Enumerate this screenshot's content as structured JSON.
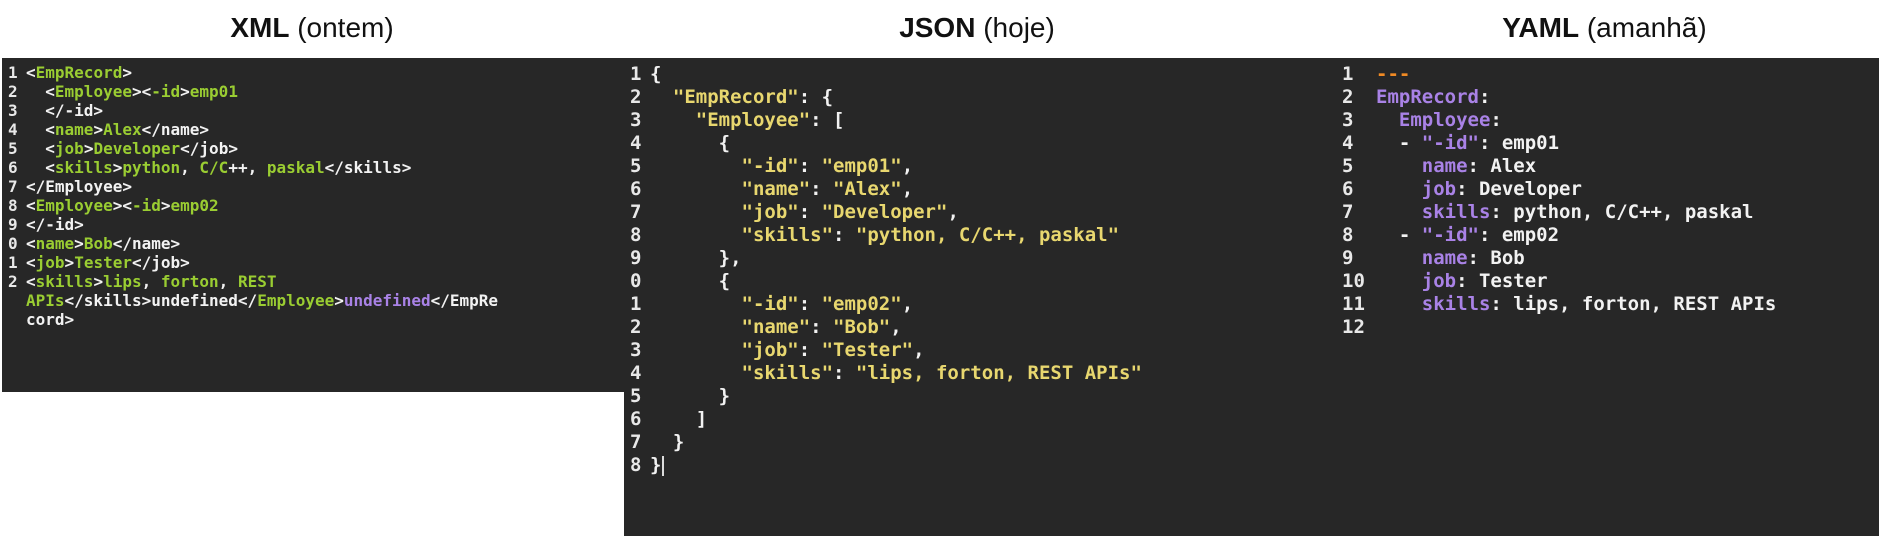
{
  "headings": {
    "xml": {
      "bold": "XML",
      "rest": "(ontem)"
    },
    "json": {
      "bold": "JSON",
      "rest": "(hoje)"
    },
    "yaml": {
      "bold": "YAML",
      "rest": "(amanhã)"
    }
  },
  "xml_panel": {
    "lines": [
      {
        "n": "1",
        "segs": [
          [
            "w",
            "<"
          ],
          [
            "g",
            "EmpRecord"
          ],
          [
            "w",
            ">"
          ]
        ]
      },
      {
        "n": "2",
        "segs": [
          [
            "w",
            "  <"
          ],
          [
            "g",
            "Employee"
          ],
          [
            "w",
            "><"
          ],
          [
            "g",
            "-id"
          ],
          [
            "w",
            ">"
          ],
          [
            "g",
            "emp01"
          ]
        ]
      },
      {
        "n": "3",
        "segs": [
          [
            "w",
            "  </"
          ],
          [
            "w",
            "-id>"
          ]
        ]
      },
      {
        "n": "4",
        "segs": [
          [
            "w",
            "  <"
          ],
          [
            "g",
            "name"
          ],
          [
            "w",
            ">"
          ],
          [
            "g",
            "Alex"
          ],
          [
            "w",
            "</name>"
          ]
        ]
      },
      {
        "n": "5",
        "segs": [
          [
            "w",
            "  <"
          ],
          [
            "g",
            "job"
          ],
          [
            "w",
            ">"
          ],
          [
            "g",
            "Developer"
          ],
          [
            "w",
            "</job>"
          ]
        ]
      },
      {
        "n": "6",
        "segs": [
          [
            "w",
            "  <"
          ],
          [
            "g",
            "skills"
          ],
          [
            "w",
            ">"
          ],
          [
            "g",
            "python"
          ],
          [
            "w",
            ", "
          ],
          [
            "g",
            "C/C"
          ],
          [
            "w",
            "++, "
          ],
          [
            "g",
            "paskal"
          ],
          [
            "w",
            "</skills>"
          ]
        ]
      },
      {
        "n": "7",
        "segs": [
          [
            "w",
            "</Employee>"
          ]
        ]
      },
      {
        "n": "8",
        "segs": [
          [
            "w",
            "<"
          ],
          [
            "g",
            "Employee"
          ],
          [
            "w",
            "><"
          ],
          [
            "g",
            "-id"
          ],
          [
            "w",
            ">"
          ],
          [
            "g",
            "emp02"
          ]
        ]
      },
      {
        "n": "9",
        "segs": [
          [
            "w",
            "</-id>"
          ]
        ]
      },
      {
        "n": "0",
        "segs": [
          [
            "w",
            "<"
          ],
          [
            "g",
            "name"
          ],
          [
            "w",
            ">"
          ],
          [
            "g",
            "Bob"
          ],
          [
            "w",
            "</name>"
          ]
        ]
      },
      {
        "n": "1",
        "segs": [
          [
            "w",
            "<"
          ],
          [
            "g",
            "job"
          ],
          [
            "w",
            ">"
          ],
          [
            "g",
            "Tester"
          ],
          [
            "w",
            "</job>"
          ]
        ]
      },
      {
        "n": "2",
        "segs": [
          [
            "w",
            "<"
          ],
          [
            "g",
            "skills"
          ],
          [
            "w",
            ">"
          ],
          [
            "g",
            "lips"
          ],
          [
            "w",
            ", "
          ],
          [
            "g",
            "forton"
          ],
          [
            "w",
            ", "
          ],
          [
            "g",
            "REST"
          ]
        ]
      },
      {
        "n": "",
        "segs": [
          [
            "g",
            "APIs"
          ],
          [
            "w",
            "</skills>undefined</"
          ],
          [
            "g",
            "Employee"
          ],
          [
            "w",
            ">"
          ],
          [
            "p",
            "undefined"
          ],
          [
            "w",
            "</EmpRe"
          ]
        ]
      },
      {
        "n": "",
        "segs": [
          [
            "w",
            "cord>"
          ]
        ]
      }
    ]
  },
  "json_panel": {
    "lines": [
      {
        "n": "1",
        "segs": [
          [
            "w",
            "{"
          ]
        ]
      },
      {
        "n": "2",
        "segs": [
          [
            "y",
            "  \"EmpRecord\""
          ],
          [
            "w",
            ": {"
          ]
        ]
      },
      {
        "n": "3",
        "segs": [
          [
            "y",
            "    \"Employee\""
          ],
          [
            "w",
            ": ["
          ]
        ]
      },
      {
        "n": "4",
        "segs": [
          [
            "w",
            "      {"
          ]
        ]
      },
      {
        "n": "5",
        "segs": [
          [
            "y",
            "        \"-id\""
          ],
          [
            "w",
            ": "
          ],
          [
            "y",
            "\"emp01\""
          ],
          [
            "w",
            ","
          ]
        ]
      },
      {
        "n": "6",
        "segs": [
          [
            "y",
            "        \"name\""
          ],
          [
            "w",
            ": "
          ],
          [
            "y",
            "\"Alex\""
          ],
          [
            "w",
            ","
          ]
        ]
      },
      {
        "n": "7",
        "segs": [
          [
            "y",
            "        \"job\""
          ],
          [
            "w",
            ": "
          ],
          [
            "y",
            "\"Developer\""
          ],
          [
            "w",
            ","
          ]
        ]
      },
      {
        "n": "8",
        "segs": [
          [
            "y",
            "        \"skills\""
          ],
          [
            "w",
            ": "
          ],
          [
            "y",
            "\"python, C/C++, paskal\""
          ]
        ]
      },
      {
        "n": "9",
        "segs": [
          [
            "w",
            "      },"
          ]
        ]
      },
      {
        "n": "0",
        "segs": [
          [
            "w",
            "      {"
          ]
        ]
      },
      {
        "n": "1",
        "segs": [
          [
            "y",
            "        \"-id\""
          ],
          [
            "w",
            ": "
          ],
          [
            "y",
            "\"emp02\""
          ],
          [
            "w",
            ","
          ]
        ]
      },
      {
        "n": "2",
        "segs": [
          [
            "y",
            "        \"name\""
          ],
          [
            "w",
            ": "
          ],
          [
            "y",
            "\"Bob\""
          ],
          [
            "w",
            ","
          ]
        ]
      },
      {
        "n": "3",
        "segs": [
          [
            "y",
            "        \"job\""
          ],
          [
            "w",
            ": "
          ],
          [
            "y",
            "\"Tester\""
          ],
          [
            "w",
            ","
          ]
        ]
      },
      {
        "n": "4",
        "segs": [
          [
            "y",
            "        \"skills\""
          ],
          [
            "w",
            ": "
          ],
          [
            "y",
            "\"lips, forton, REST APIs\""
          ]
        ]
      },
      {
        "n": "5",
        "segs": [
          [
            "w",
            "      }"
          ]
        ]
      },
      {
        "n": "6",
        "segs": [
          [
            "w",
            "    ]"
          ]
        ]
      },
      {
        "n": "7",
        "segs": [
          [
            "w",
            "  }"
          ]
        ]
      },
      {
        "n": "8",
        "segs": [
          [
            "w",
            "}"
          ]
        ]
      }
    ]
  },
  "yaml_panel": {
    "lines": [
      {
        "n": "1",
        "segs": [
          [
            "o",
            "---"
          ]
        ]
      },
      {
        "n": "2",
        "segs": [
          [
            "p",
            "EmpRecord"
          ],
          [
            "w",
            ":"
          ]
        ]
      },
      {
        "n": "3",
        "segs": [
          [
            "p",
            "  Employee"
          ],
          [
            "w",
            ":"
          ]
        ]
      },
      {
        "n": "4",
        "segs": [
          [
            "w",
            "  - "
          ],
          [
            "p",
            "\"-id\""
          ],
          [
            "w",
            ": emp01"
          ]
        ]
      },
      {
        "n": "5",
        "segs": [
          [
            "p",
            "    name"
          ],
          [
            "w",
            ": Alex"
          ]
        ]
      },
      {
        "n": "6",
        "segs": [
          [
            "p",
            "    job"
          ],
          [
            "w",
            ": Developer"
          ]
        ]
      },
      {
        "n": "7",
        "segs": [
          [
            "p",
            "    skills"
          ],
          [
            "w",
            ": python, C/C++, paskal"
          ]
        ]
      },
      {
        "n": "8",
        "segs": [
          [
            "w",
            "  - "
          ],
          [
            "p",
            "\"-id\""
          ],
          [
            "w",
            ": emp02"
          ]
        ]
      },
      {
        "n": "9",
        "segs": [
          [
            "p",
            "    name"
          ],
          [
            "w",
            ": Bob"
          ]
        ]
      },
      {
        "n": "10",
        "segs": [
          [
            "p",
            "    job"
          ],
          [
            "w",
            ": Tester"
          ]
        ]
      },
      {
        "n": "11",
        "segs": [
          [
            "p",
            "    skills"
          ],
          [
            "w",
            ": lips, forton, REST APIs"
          ]
        ]
      },
      {
        "n": "12",
        "segs": []
      }
    ]
  },
  "colors": {
    "panel_bg": "#272727",
    "green": "#9acd32",
    "purple": "#a982e6",
    "yellow": "#e8d76f",
    "orange": "#f08a24"
  }
}
